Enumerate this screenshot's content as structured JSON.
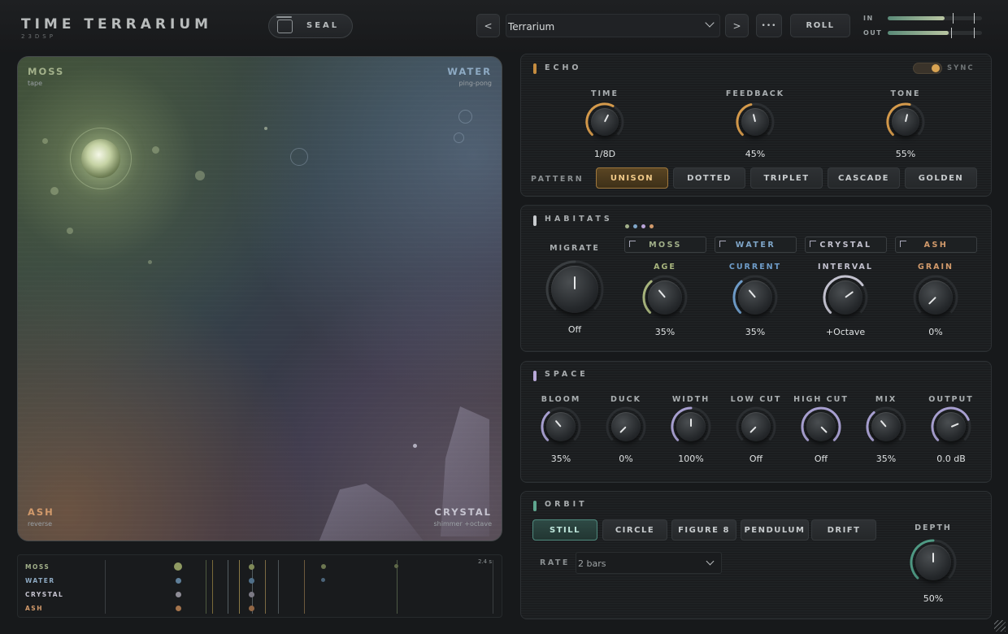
{
  "brand": {
    "title": "TIME TERRARIUM",
    "subtitle": "23DSP"
  },
  "header": {
    "seal_label": "SEAL",
    "prev_label": "<",
    "next_label": ">",
    "more_label": "•••",
    "roll_label": "ROLL",
    "preset": "Terrarium",
    "meters": [
      {
        "label": "IN",
        "level": 0.6
      },
      {
        "label": "OUT",
        "level": 0.65
      }
    ]
  },
  "field": {
    "corners": [
      {
        "name": "MOSS",
        "sub": "tape",
        "color": "#a2b08a"
      },
      {
        "name": "WATER",
        "sub": "ping-pong",
        "color": "#8eaac3"
      },
      {
        "name": "ASH",
        "sub": "reverse",
        "color": "#d29a6b"
      },
      {
        "name": "CRYSTAL",
        "sub": "shimmer +octave",
        "color": "#c6c4d0"
      }
    ]
  },
  "timeline": {
    "time": "2.4 s",
    "lanes": [
      "MOSS",
      "WATER",
      "CRYSTAL",
      "ASH"
    ]
  },
  "echo": {
    "title": "ECHO",
    "sync_label": "SYNC",
    "pattern_label": "PATTERN",
    "knobs": [
      {
        "label": "TIME",
        "value": "1/8D",
        "amount": 0.6
      },
      {
        "label": "FEEDBACK",
        "value": "45%",
        "amount": 0.45
      },
      {
        "label": "TONE",
        "value": "55%",
        "amount": 0.55
      }
    ],
    "patterns": [
      "UNISON",
      "DOTTED",
      "TRIPLET",
      "CASCADE",
      "GOLDEN"
    ],
    "active_pattern": "UNISON"
  },
  "habitats": {
    "title": "HABITATS",
    "migrate": {
      "label": "MIGRATE",
      "value": "Off"
    },
    "chips": [
      {
        "label": "MOSS",
        "color": "#a2b08a"
      },
      {
        "label": "WATER",
        "color": "#7fa6c9"
      },
      {
        "label": "CRYSTAL",
        "color": "#c3c2cf"
      },
      {
        "label": "ASH",
        "color": "#d29a6b"
      }
    ],
    "knobs": [
      {
        "label": "AGE",
        "value": "35%",
        "color": "#a8b57d",
        "amount": 0.35
      },
      {
        "label": "CURRENT",
        "value": "35%",
        "color": "#6e9cc9",
        "amount": 0.35
      },
      {
        "label": "INTERVAL",
        "value": "+Octave",
        "color": "#c3c2cf",
        "amount": 0.7
      },
      {
        "label": "GRAIN",
        "value": "0%",
        "color": "#d29a6b",
        "amount": 0.0
      }
    ]
  },
  "space": {
    "title": "SPACE",
    "knobs": [
      {
        "label": "BLOOM",
        "value": "35%",
        "amount": 0.35
      },
      {
        "label": "DUCK",
        "value": "0%",
        "amount": 0.0
      },
      {
        "label": "WIDTH",
        "value": "100%",
        "amount": 0.5
      },
      {
        "label": "LOW CUT",
        "value": "Off",
        "amount": 0.0
      },
      {
        "label": "HIGH CUT",
        "value": "Off",
        "amount": 1.0
      },
      {
        "label": "MIX",
        "value": "35%",
        "amount": 0.35
      },
      {
        "label": "OUTPUT",
        "value": "0.0 dB",
        "amount": 0.75
      }
    ]
  },
  "orbit": {
    "title": "ORBIT",
    "modes": [
      "STILL",
      "CIRCLE",
      "FIGURE 8",
      "PENDULUM",
      "DRIFT"
    ],
    "active_mode": "STILL",
    "rate_label": "RATE",
    "rate_value": "2 bars",
    "depth": {
      "label": "DEPTH",
      "value": "50%",
      "amount": 0.5
    }
  }
}
